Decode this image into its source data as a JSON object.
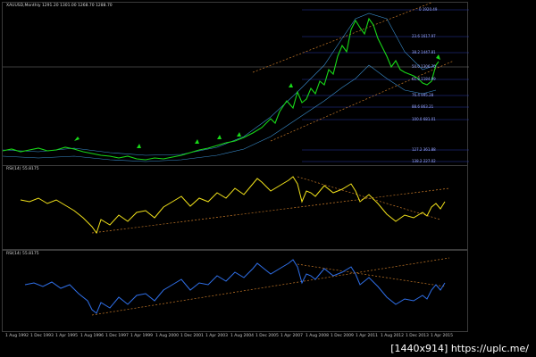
{
  "app": {
    "title": "Gold price chart with RSI indicators"
  },
  "main_pane": {
    "label": "XAUUSD,Monthly  1291.20 1301.00 1268.70 1288.70",
    "fib_levels": [
      "0 1920.49",
      "23.6 1617.97",
      "38.2 1447.81",
      "50.0 1306.70",
      "61.8 1184.99",
      "76.4 995.28",
      "88.6 863.21",
      "100.0 681.01",
      "127.2 361.88",
      "138.2 227.02"
    ]
  },
  "rsi_pane_1": {
    "label": "RSI(14) 55.8175"
  },
  "rsi_pane_2": {
    "label": "RSI(14) 55.8175"
  },
  "xaxis": {
    "labels": [
      "1 Aug 1992",
      "1 Dec 1993",
      "1 Apr 1995",
      "1 Aug 1996",
      "1 Dec 1997",
      "1 Apr 1999",
      "1 Aug 2000",
      "1 Dec 2001",
      "1 Apr 2003",
      "1 Aug 2004",
      "1 Dec 2005",
      "1 Apr 2007",
      "1 Aug 2008",
      "1 Dec 2009",
      "1 Apr 2011",
      "1 Aug 2012",
      "1 Dec 2013",
      "1 Apr 2015"
    ]
  },
  "watermark": "[1440x914] https://uplc.me/",
  "colors": {
    "price": "#18d818",
    "rsi1": "#f2e21a",
    "rsi2": "#2f6fe8",
    "trend": "#c87a28",
    "bands": "#3a8fd0",
    "fib": "#3a46c8"
  }
}
